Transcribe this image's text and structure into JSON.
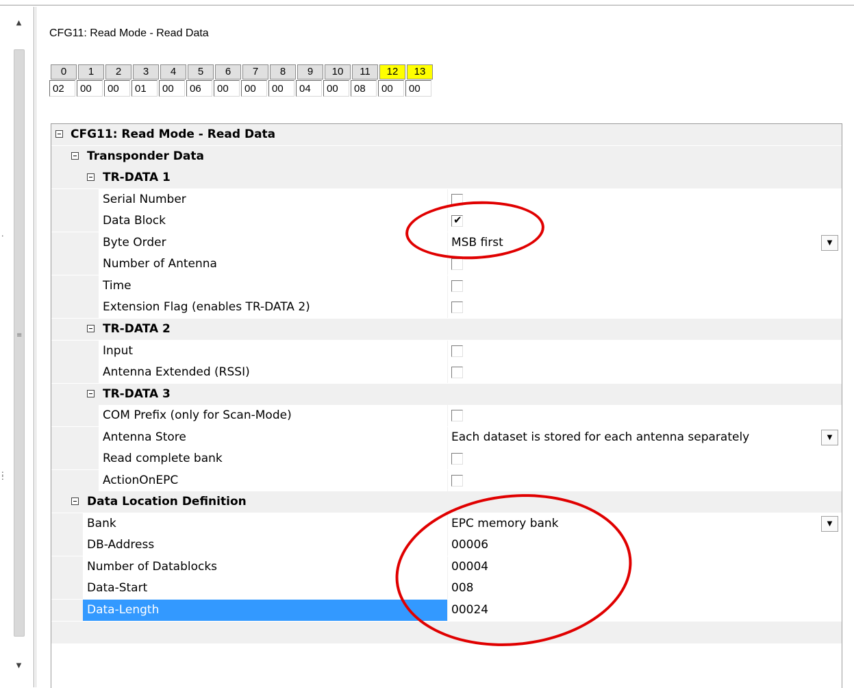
{
  "page_title": "CFG11: Read Mode - Read Data",
  "bytes": [
    {
      "index": "0",
      "value": "02",
      "highlight": false
    },
    {
      "index": "1",
      "value": "00",
      "highlight": false
    },
    {
      "index": "2",
      "value": "00",
      "highlight": false
    },
    {
      "index": "3",
      "value": "01",
      "highlight": false
    },
    {
      "index": "4",
      "value": "00",
      "highlight": false
    },
    {
      "index": "5",
      "value": "06",
      "highlight": false
    },
    {
      "index": "6",
      "value": "00",
      "highlight": false
    },
    {
      "index": "7",
      "value": "00",
      "highlight": false
    },
    {
      "index": "8",
      "value": "00",
      "highlight": false
    },
    {
      "index": "9",
      "value": "04",
      "highlight": false
    },
    {
      "index": "10",
      "value": "00",
      "highlight": false
    },
    {
      "index": "11",
      "value": "08",
      "highlight": false
    },
    {
      "index": "12",
      "value": "00",
      "highlight": true
    },
    {
      "index": "13",
      "value": "00",
      "highlight": true
    }
  ],
  "grid": {
    "root": "CFG11: Read Mode - Read Data",
    "transponder_data": "Transponder Data",
    "tr_data_1": {
      "title": "TR-DATA 1",
      "serial_number": {
        "label": "Serial Number",
        "checked": false
      },
      "data_block": {
        "label": "Data Block",
        "checked": true
      },
      "byte_order": {
        "label": "Byte Order",
        "value": "MSB first"
      },
      "number_of_antenna": {
        "label": "Number of Antenna",
        "checked": false
      },
      "time": {
        "label": "Time",
        "checked": false
      },
      "extension_flag": {
        "label": "Extension Flag (enables TR-DATA 2)",
        "checked": false
      }
    },
    "tr_data_2": {
      "title": "TR-DATA 2",
      "input": {
        "label": "Input",
        "checked": false
      },
      "antenna_extended": {
        "label": "Antenna Extended (RSSI)",
        "checked": false
      }
    },
    "tr_data_3": {
      "title": "TR-DATA 3",
      "com_prefix": {
        "label": "COM Prefix (only for Scan-Mode)",
        "checked": false
      },
      "antenna_store": {
        "label": "Antenna Store",
        "value": "Each dataset is stored for each antenna separately"
      },
      "read_complete_bank": {
        "label": "Read complete bank",
        "checked": false
      },
      "action_on_epc": {
        "label": "ActionOnEPC",
        "checked": false
      }
    },
    "data_location": {
      "title": "Data Location Definition",
      "bank": {
        "label": "Bank",
        "value": "EPC memory bank"
      },
      "db_address": {
        "label": "DB-Address",
        "value": "00006"
      },
      "number_of_datablocks": {
        "label": "Number of Datablocks",
        "value": "00004"
      },
      "data_start": {
        "label": "Data-Start",
        "value": "008"
      },
      "data_length": {
        "label": "Data-Length",
        "value": "00024"
      }
    }
  },
  "colors": {
    "highlight_byte": "#ffff00",
    "selection": "#3399ff",
    "annotation": "#e00000",
    "category_bg": "#f0f0f0"
  }
}
